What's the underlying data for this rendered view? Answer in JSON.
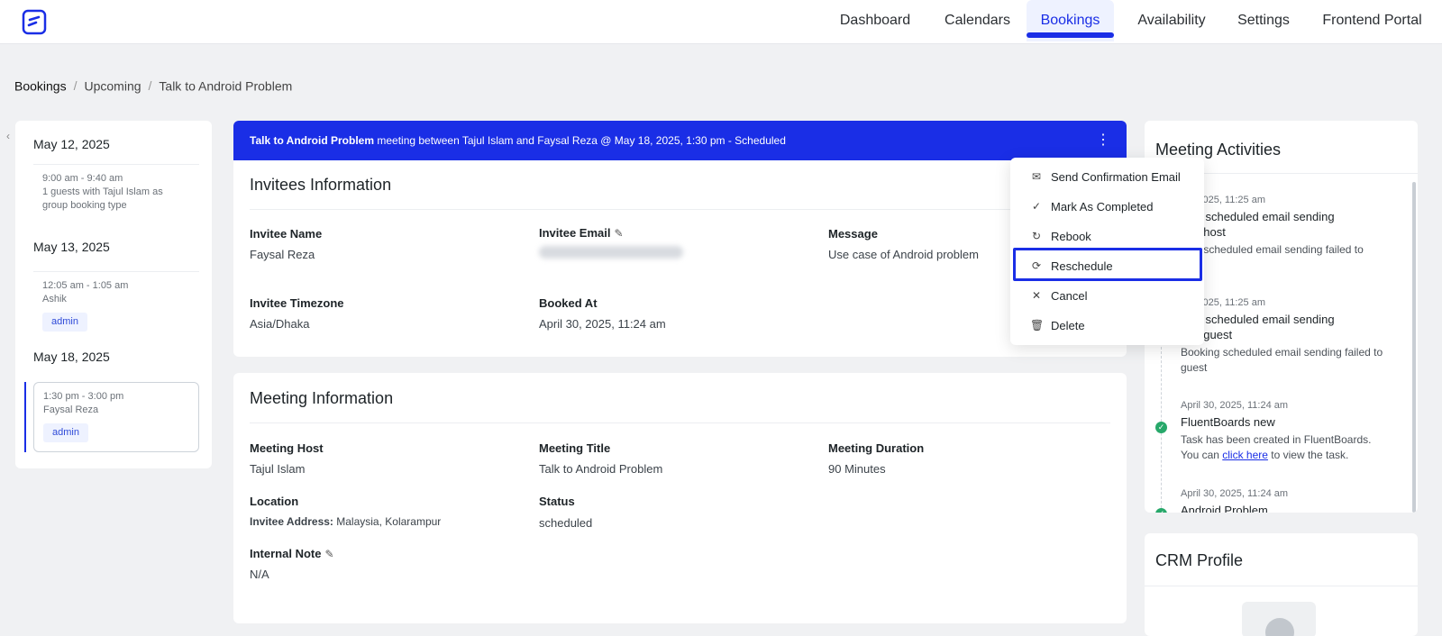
{
  "nav": {
    "items": [
      "Dashboard",
      "Calendars",
      "Bookings",
      "Availability",
      "Settings",
      "Frontend Portal"
    ],
    "active": "Bookings"
  },
  "breadcrumb": [
    "Bookings",
    "Upcoming",
    "Talk to Android Problem"
  ],
  "left_panel": {
    "groups": [
      {
        "date": "May 12, 2025",
        "slots": [
          {
            "time": "9:00 am - 9:40 am",
            "line2": "1 guests with Tajul Islam as",
            "line3": "group booking type"
          }
        ]
      },
      {
        "date": "May 13, 2025",
        "slots": [
          {
            "time": "12:05 am - 1:05 am",
            "name": "Ashik",
            "tag": "admin"
          }
        ]
      },
      {
        "date": "May 18, 2025",
        "slots": [
          {
            "time": "1:30 pm - 3:00 pm",
            "name": "Faysal Reza",
            "tag": "admin"
          }
        ]
      }
    ]
  },
  "header_band": {
    "event": "Talk to Android Problem",
    "text": " meeting between Tajul Islam and Faysal Reza @ May 18, 2025, 1:30 pm - Scheduled",
    "menu_icon": "kebab-vertical-icon"
  },
  "invitees": {
    "title": "Invitees Information",
    "name_label": "Invitee Name",
    "name_value": "Faysal Reza",
    "email_label": "Invitee Email",
    "message_label": "Message",
    "message_value": "Use case of Android problem",
    "timezone_label": "Invitee Timezone",
    "timezone_value": "Asia/Dhaka",
    "booked_label": "Booked At",
    "booked_value": "April 30, 2025, 11:24 am"
  },
  "meeting": {
    "title": "Meeting Information",
    "host_label": "Meeting Host",
    "host_value": "Tajul Islam",
    "mtitle_label": "Meeting Title",
    "mtitle_value": "Talk to Android Problem",
    "duration_label": "Meeting Duration",
    "duration_value": "90 Minutes",
    "location_label": "Location",
    "location_prefix": "Invitee Address:",
    "location_value": " Malaysia, Kolarampur",
    "status_label": "Status",
    "status_value": "scheduled",
    "note_label": "Internal Note",
    "note_value": "N/A"
  },
  "dropdown": {
    "items": [
      {
        "label": "Send Confirmation Email",
        "icon": "mail-icon"
      },
      {
        "label": "Mark As Completed",
        "icon": "check-icon"
      },
      {
        "label": "Rebook",
        "icon": "refresh-icon"
      },
      {
        "label": "Reschedule",
        "icon": "reschedule-icon"
      },
      {
        "label": "Cancel",
        "icon": "close-icon"
      },
      {
        "label": "Delete",
        "icon": "trash-icon"
      }
    ],
    "highlighted": "Reschedule"
  },
  "activities": {
    "title": "Meeting Activities",
    "items": [
      {
        "time": "30, 2025, 11:25 am",
        "head1": "king scheduled email sending",
        "head2": "d to host",
        "desc": "king scheduled email sending failed to"
      },
      {
        "time": "30, 2025, 11:25 am",
        "head1": "king scheduled email sending",
        "head2": "d to guest",
        "desc": "Booking scheduled email sending failed to guest"
      },
      {
        "time": "April 30, 2025, 11:24 am",
        "head1": "FluentBoards new",
        "desc1": "Task has been created in FluentBoards.",
        "desc2_pre": "You can ",
        "link": "click here",
        "desc2_post": " to view the task."
      },
      {
        "time": "April 30, 2025, 11:24 am",
        "head1": "Android Problem"
      }
    ]
  },
  "crm": {
    "title": "CRM Profile"
  },
  "colors": {
    "accent": "#1a2ee6",
    "success": "#27a86a"
  }
}
